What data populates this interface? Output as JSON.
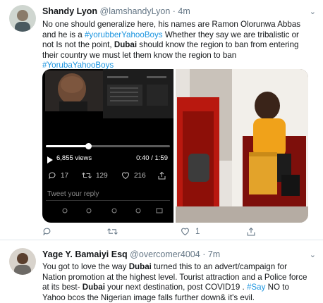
{
  "tweets": [
    {
      "name": "Shandy Lyon",
      "handle": "@lamshandyLyon",
      "time": "4m",
      "text": {
        "p1": "No one should generalize here, his names are Ramon Olorunwa Abbas and he is a ",
        "tag1": "#yorubberYahooBoys",
        "p2": "  Whether they say we are tribalistic or not Is not the point, ",
        "bold1": "Dubai",
        "p3": " should know the region to ban from entering their country we must let them know the region to ban",
        "tag2": "#YorubaYahooBoys"
      },
      "video": {
        "views": "6,855 views",
        "time": "0:40 / 1:59",
        "progress_fraction": 0.34,
        "replies": "17",
        "retweets": "129",
        "likes": "216",
        "reply_placeholder": "Tweet your reply"
      },
      "actions": {
        "replies": "",
        "retweets": "",
        "likes": "1"
      }
    },
    {
      "name": "Yage Y. Bamaiyi Esq",
      "handle": "@overcomer4004",
      "time": "7m",
      "text": {
        "p1": "You got to love the way ",
        "bold1": "Dubai",
        "p2": " turned this to an advert/campaign for Nation promotion at the highest level. Tourist attraction and a Police force at its best- ",
        "bold2": "Dubai",
        "p3": " your next destination, post COVID19 . ",
        "tag1": "#Say",
        "p4": " NO to Yahoo bcos the Nigerian image falls further down& it's evil."
      }
    }
  ],
  "colors": {
    "link": "#1b95e0",
    "secondary": "#657786",
    "divider": "#e1e8ed"
  },
  "icons": [
    "reply-icon",
    "retweet-icon",
    "like-icon",
    "share-icon",
    "chevron-down-icon",
    "play-icon"
  ]
}
